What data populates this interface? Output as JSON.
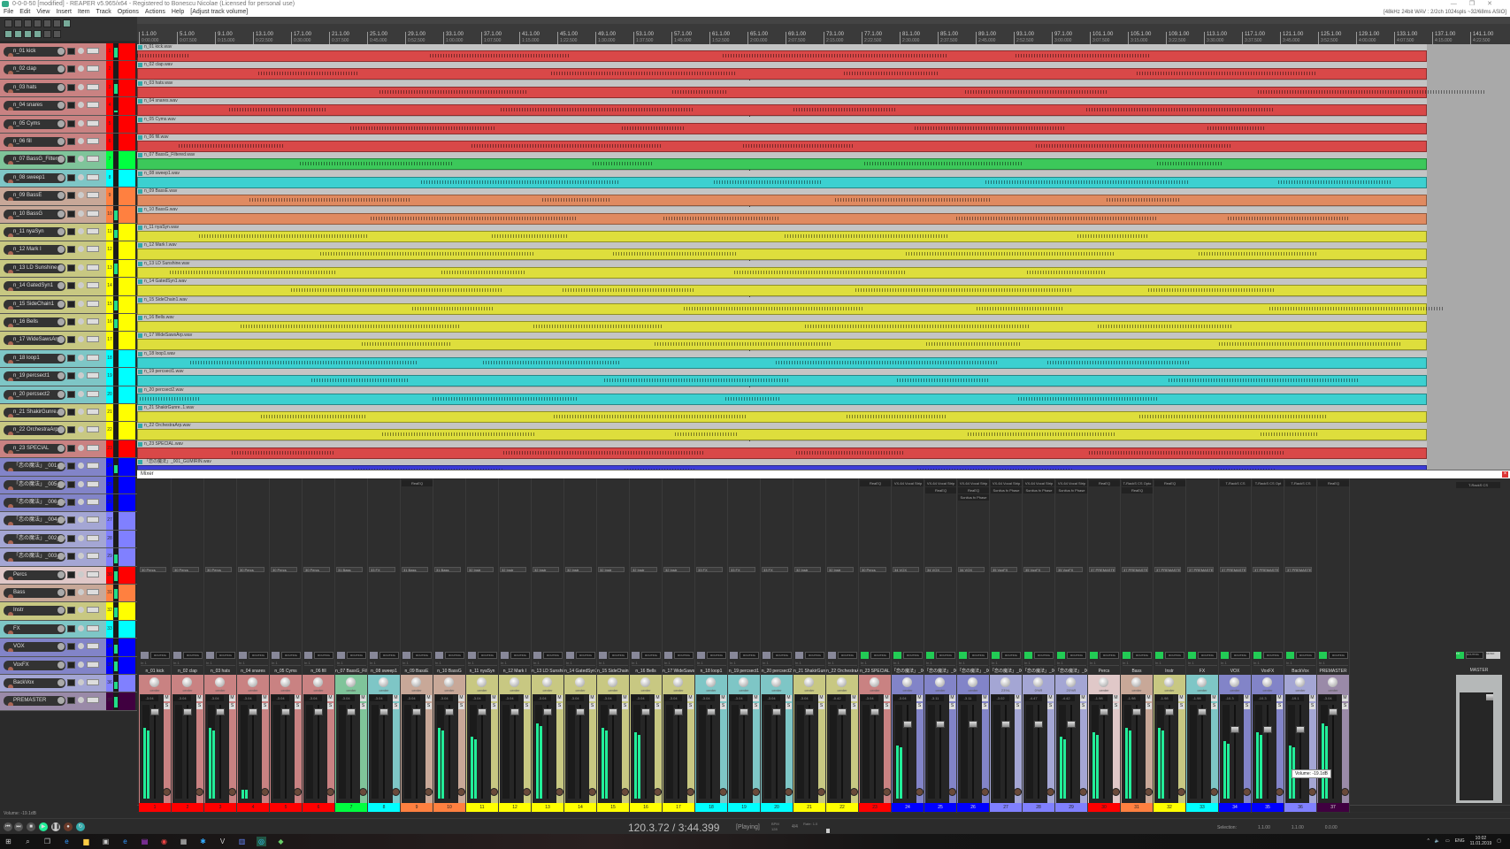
{
  "window": {
    "title": "0-0-0-50 [modified] - REAPER v5.965/x64 - Registered to Bonescu Nicolae (Licensed for personal use)",
    "controls": [
      "—",
      "❐",
      "✕"
    ]
  },
  "menu": {
    "items": [
      "File",
      "Edit",
      "View",
      "Insert",
      "Item",
      "Track",
      "Options",
      "Actions",
      "Help",
      "[Adjust track volume]"
    ],
    "audio_status": "[48kHz 24bit WAV : 2/2ch 1024spls ~32/68ms ASIO]"
  },
  "ruler": {
    "bars": [
      "1.1.00",
      "5.1.00",
      "9.1.00",
      "13.1.00",
      "17.1.00",
      "21.1.00",
      "25.1.00",
      "29.1.00",
      "33.1.00",
      "37.1.00",
      "41.1.00",
      "45.1.00",
      "49.1.00",
      "53.1.00",
      "57.1.00",
      "61.1.00",
      "65.1.00",
      "69.1.00",
      "73.1.00",
      "77.1.00",
      "81.1.00",
      "85.1.00",
      "89.1.00",
      "93.1.00",
      "97.1.00",
      "101.1.00",
      "105.1.00",
      "109.1.00",
      "113.1.00",
      "117.1.00",
      "121.1.00",
      "125.1.00",
      "129.1.00",
      "133.1.00",
      "137.1.00",
      "141.1.00"
    ],
    "times": [
      "0:00.000",
      "0:07.500",
      "0:15.000",
      "0:22.500",
      "0:30.000",
      "0:37.500",
      "0:45.000",
      "0:52.500",
      "1:00.000",
      "1:07.500",
      "1:15.000",
      "1:22.500",
      "1:30.000",
      "1:37.500",
      "1:45.000",
      "1:52.500",
      "2:00.000",
      "2:07.500",
      "2:15.000",
      "2:22.500",
      "2:30.000",
      "2:37.500",
      "2:45.000",
      "2:52.500",
      "3:00.000",
      "3:07.500",
      "3:15.000",
      "3:22.500",
      "3:30.000",
      "3:37.500",
      "3:45.000",
      "3:52.500",
      "4:00.000",
      "4:07.500",
      "4:15.000",
      "4:22.500"
    ]
  },
  "tracks": [
    {
      "num": "1",
      "name": "n_01 kick",
      "item": "n_01 kick.wav",
      "color": "#ff0000",
      "tint": "#c98282",
      "item_color": "#d94848",
      "meter": 0.8,
      "pan": "center",
      "vol": "-3.04",
      "send": "30 Percs",
      "fx": []
    },
    {
      "num": "2",
      "name": "n_02 clap",
      "item": "n_02 clap.wav",
      "color": "#ff0000",
      "tint": "#c98282",
      "item_color": "#d94848",
      "meter": 0,
      "pan": "center",
      "vol": "-3.04",
      "send": "30 Percs",
      "fx": []
    },
    {
      "num": "3",
      "name": "n_03 hats",
      "item": "n_03 hats.wav",
      "color": "#ff0000",
      "tint": "#c98282",
      "item_color": "#d94848",
      "meter": 0.8,
      "pan": "center",
      "vol": "-3.04",
      "send": "30 Percs",
      "fx": []
    },
    {
      "num": "4",
      "name": "n_04 snares",
      "item": "n_04 snares.wav",
      "color": "#ff0000",
      "tint": "#c98282",
      "item_color": "#d94848",
      "meter": 0.1,
      "pan": "center",
      "vol": "-3.04",
      "send": "30 Percs",
      "fx": []
    },
    {
      "num": "5",
      "name": "n_05 Cyms",
      "item": "n_05 Cyms.wav",
      "color": "#ff0000",
      "tint": "#c98282",
      "item_color": "#d94848",
      "meter": 0,
      "pan": "center",
      "vol": "-3.04",
      "send": "30 Percs",
      "fx": []
    },
    {
      "num": "6",
      "name": "n_06 fill",
      "item": "n_06 fill.wav",
      "color": "#ff0000",
      "tint": "#c98282",
      "item_color": "#d94848",
      "meter": 0,
      "pan": "center",
      "vol": "-3.04",
      "send": "30 Percs",
      "fx": []
    },
    {
      "num": "7",
      "name": "n_07 BassG_Filtered",
      "item": "n_07 BassG_Filtered.wav",
      "color": "#00ff40",
      "tint": "#7fc49a",
      "item_color": "#3cc85a",
      "meter": 0,
      "pan": "center",
      "vol": "-3.04",
      "send": "31 Bass",
      "fx": []
    },
    {
      "num": "8",
      "name": "n_08 sweep1",
      "item": "n_08 sweep1.wav",
      "color": "#00ffff",
      "tint": "#7ec6c6",
      "item_color": "#3cd0d0",
      "meter": 0,
      "pan": "center",
      "vol": "-3.04",
      "send": "33 FX",
      "fx": []
    },
    {
      "num": "9",
      "name": "n_09 BassE",
      "item": "n_09 BassE.wav",
      "color": "#ff8040",
      "tint": "#c8a898",
      "item_color": "#e08a60",
      "meter": 0,
      "pan": "center",
      "vol": "-3.04",
      "send": "31 Bass",
      "fx": [
        "ReaEQ"
      ]
    },
    {
      "num": "10",
      "name": "n_10 BassG",
      "item": "n_10 BassG.wav",
      "color": "#ff8040",
      "tint": "#c8a898",
      "item_color": "#e08a60",
      "meter": 0.8,
      "pan": "center",
      "vol": "-3.04",
      "send": "31 Bass",
      "fx": []
    },
    {
      "num": "11",
      "name": "n_11 nyaSyn",
      "item": "n_11 nyaSyn.wav",
      "color": "#ffff00",
      "tint": "#c8c882",
      "item_color": "#dede3c",
      "meter": 0.7,
      "pan": "center",
      "vol": "-3.04",
      "send": "32 Instr",
      "fx": []
    },
    {
      "num": "12",
      "name": "n_12 Mark I",
      "item": "n_12 Mark I.wav",
      "color": "#ffff00",
      "tint": "#c8c882",
      "item_color": "#dede3c",
      "meter": 0,
      "pan": "center",
      "vol": "-3.04",
      "send": "32 Instr",
      "fx": []
    },
    {
      "num": "13",
      "name": "n_13 LD Sunshine",
      "item": "n_13 LD Sunshine.wav",
      "color": "#ffff00",
      "tint": "#c8c882",
      "item_color": "#dede3c",
      "meter": 0.85,
      "pan": "center",
      "vol": "-3.04",
      "send": "32 Instr",
      "fx": []
    },
    {
      "num": "14",
      "name": "n_14 GatedSyn1",
      "item": "n_14 GatedSyn1.wav",
      "color": "#ffff00",
      "tint": "#c8c882",
      "item_color": "#dede3c",
      "meter": 0,
      "pan": "center",
      "vol": "-3.04",
      "send": "32 Instr",
      "fx": []
    },
    {
      "num": "15",
      "name": "n_15 SideChain1",
      "item": "n_15 SideChain1.wav",
      "color": "#ffff00",
      "tint": "#c8c882",
      "item_color": "#dede3c",
      "meter": 0.8,
      "pan": "center",
      "vol": "-3.04",
      "send": "32 Instr",
      "fx": []
    },
    {
      "num": "16",
      "name": "n_16 Bells",
      "item": "n_16 Bells.wav",
      "color": "#ffff00",
      "tint": "#c8c882",
      "item_color": "#dede3c",
      "meter": 0.75,
      "pan": "center",
      "vol": "-3.04",
      "send": "32 Instr",
      "fx": []
    },
    {
      "num": "17",
      "name": "n_17 WideSawsArp",
      "item": "n_17 WideSawsArp.wav",
      "color": "#ffff00",
      "tint": "#c8c882",
      "item_color": "#dede3c",
      "meter": 0,
      "pan": "center",
      "vol": "-3.04",
      "send": "32 Instr",
      "fx": []
    },
    {
      "num": "18",
      "name": "n_18 loop1",
      "item": "n_18 loop1.wav",
      "color": "#00ffff",
      "tint": "#7ec6c6",
      "item_color": "#3cd0d0",
      "meter": 0,
      "pan": "center",
      "vol": "-3.04",
      "send": "33 FX",
      "fx": []
    },
    {
      "num": "19",
      "name": "n_19 percsect1",
      "item": "n_19 percsect1.wav",
      "color": "#00ffff",
      "tint": "#7ec6c6",
      "item_color": "#3cd0d0",
      "meter": 0,
      "pan": "center",
      "vol": "-3.04",
      "send": "33 FX",
      "fx": []
    },
    {
      "num": "20",
      "name": "n_20 percsect2",
      "item": "n_20 percsect2.wav",
      "color": "#00ffff",
      "tint": "#7ec6c6",
      "item_color": "#3cd0d0",
      "meter": 0,
      "pan": "center",
      "vol": "-3.04",
      "send": "33 FX",
      "fx": []
    },
    {
      "num": "21",
      "name": "n_21 ShakirGunre..1",
      "item": "n_21 ShakirGunre..1.wav",
      "color": "#ffff00",
      "tint": "#c8c882",
      "item_color": "#dede3c",
      "meter": 0,
      "pan": "center",
      "vol": "-3.04",
      "send": "32 Instr",
      "fx": []
    },
    {
      "num": "22",
      "name": "n_22 OrchestraArp",
      "item": "n_22 OrchestraArp.wav",
      "color": "#ffff00",
      "tint": "#c8c882",
      "item_color": "#dede3c",
      "meter": 0,
      "pan": "center",
      "vol": "-0.42",
      "send": "32 Instr",
      "fx": []
    },
    {
      "num": "23",
      "name": "n_23 SPECIAL",
      "item": "n_23 SPECIAL.wav",
      "color": "#ff0000",
      "tint": "#c98282",
      "item_color": "#d94848",
      "meter": 0,
      "pan": "center",
      "vol": "-3.04",
      "send": "30 Percs",
      "fx": [
        "ReaEQ"
      ]
    },
    {
      "num": "24",
      "name": "「恋の魔法」_001_GUMI",
      "item": "「恋の魔法」_001_GUMIRIN.wav",
      "color": "#0000ff",
      "tint": "#8284c8",
      "item_color": "#3c3cd8",
      "meter": 0.6,
      "pan": "center",
      "vol": "-3.04",
      "send": "34 VOX",
      "fx": [
        "VX-64 Vocal Strip"
      ]
    },
    {
      "num": "25",
      "name": "「恋の魔法」_005_GUMI",
      "item": "",
      "color": "#0000ff",
      "tint": "#8284c8",
      "item_color": "#3c3cd8",
      "meter": 0,
      "pan": "center",
      "vol": "-3.11",
      "send": "34 VOX",
      "fx": [
        "VX-64 Vocal Strip",
        "ReaEQ"
      ]
    },
    {
      "num": "26",
      "name": "「恋の魔法」_006_GUMI",
      "item": "",
      "color": "#0000ff",
      "tint": "#8284c8",
      "item_color": "#3c3cd8",
      "meter": 0,
      "pan": "center",
      "vol": "-3.11",
      "send": "34 VOX",
      "fx": [
        "VX-64 Vocal Strip",
        "ReaEQ",
        "Sonitus fx Phase"
      ]
    },
    {
      "num": "27",
      "name": "「恋の魔法」_004_GI_1",
      "item": "",
      "color": "#8080ff",
      "tint": "#a4a6d4",
      "item_color": "#8080ff",
      "meter": 0,
      "pan": "23%L",
      "vol": "-3.02",
      "send": "35 VoxFX",
      "fx": [
        "VX-64 Vocal Strip",
        "Sonitus fx Phase"
      ]
    },
    {
      "num": "28",
      "name": "「恋の魔法」_002_GI_2",
      "item": "",
      "color": "#8080ff",
      "tint": "#a4a6d4",
      "item_color": "#8080ff",
      "meter": 0,
      "pan": "0%R",
      "vol": "-4.47",
      "send": "35 VoxFX",
      "fx": [
        "VX-64 Vocal Strip",
        "Sonitus fx Phase"
      ]
    },
    {
      "num": "29",
      "name": "「恋の魔法」_003_GI_3",
      "item": "",
      "color": "#8080ff",
      "tint": "#a4a6d4",
      "item_color": "#8080ff",
      "meter": 0.7,
      "pan": "20%R",
      "vol": "-4.42",
      "send": "35 VoxFX",
      "fx": [
        "VX-64 Vocal Strip",
        "Sonitus fx Phase"
      ]
    },
    {
      "num": "30",
      "name": "Percs",
      "item": "",
      "color": "#ff0000",
      "tint": "#e0c8c8",
      "item_color": "#d94848",
      "meter": 0.75,
      "pan": "center",
      "vol": "-1.98",
      "send": "37 PREMASTER",
      "fx": [
        "ReaEQ"
      ]
    },
    {
      "num": "31",
      "name": "Bass",
      "item": "",
      "color": "#ff8040",
      "tint": "#c8a898",
      "item_color": "#e08a60",
      "meter": 0.8,
      "pan": "center",
      "vol": "-1.98",
      "send": "37 PREMASTER",
      "fx": [
        "T-RackS CS Opto",
        "ReaEQ"
      ]
    },
    {
      "num": "32",
      "name": "Instr",
      "item": "",
      "color": "#ffff00",
      "tint": "#c8c882",
      "item_color": "#dede3c",
      "meter": 0.8,
      "pan": "center",
      "vol": "-1.98",
      "send": "37 PREMASTER",
      "fx": [
        "ReaEQ"
      ]
    },
    {
      "num": "33",
      "name": "FX",
      "item": "",
      "color": "#00ffff",
      "tint": "#7ec6c6",
      "item_color": "#3cd0d0",
      "meter": 0,
      "pan": "center",
      "vol": "-1.98",
      "send": "37 PREMASTER",
      "fx": []
    },
    {
      "num": "34",
      "name": "VOX",
      "item": "",
      "color": "#0000ff",
      "tint": "#8284c8",
      "item_color": "#3c3cd8",
      "meter": 0.65,
      "pan": "center",
      "vol": "-10.3",
      "send": "37 PREMASTER",
      "fx": [
        "T-RackS CS"
      ]
    },
    {
      "num": "35",
      "name": "VoxFX",
      "item": "",
      "color": "#0000ff",
      "tint": "#8284c8",
      "item_color": "#3c3cd8",
      "meter": 0.75,
      "pan": "center",
      "vol": "-10.3",
      "send": "37 PREMASTER",
      "fx": [
        "T-RackS CS Opt"
      ]
    },
    {
      "num": "36",
      "name": "BackVox",
      "item": "",
      "color": "#8080ff",
      "tint": "#a4a6d4",
      "item_color": "#8080ff",
      "meter": 0.6,
      "pan": "center",
      "vol": "-19.1",
      "send": "37 PREMASTER",
      "fx": [
        "T-RackS CS"
      ]
    },
    {
      "num": "37",
      "name": "PREMASTER",
      "item": "",
      "color": "#400040",
      "tint": "#9a8aa8",
      "item_color": "#8060a0",
      "meter": 0.85,
      "pan": "center",
      "vol": "-3.04",
      "send": "",
      "fx": [
        "ReaEQ"
      ]
    }
  ],
  "mixer": {
    "title": "Mixer",
    "master_label": "MASTER",
    "master_fx": "T-RackS CS",
    "fx_label": "FX",
    "routing_label": "ROUTING",
    "mono_label": "MONO",
    "input_label": "In 1",
    "mute": "M",
    "solo": "S",
    "tooltip": "Volume: -19.1dB"
  },
  "status": {
    "volume": "Volume: -19.1dB"
  },
  "transport": {
    "position": "120.3.72 / 3:44.399",
    "state": "[Playing]",
    "bpm_label": "BPM",
    "bpm": "128",
    "time_sig": "4/4",
    "rate_label": "Rate:",
    "rate": "1.0",
    "selection_label": "Selection:",
    "sel_start": "1.1.00",
    "sel_end": "1.1.00",
    "sel_len": "0.0.00"
  },
  "taskbar": {
    "lang": "ENG",
    "time": "10:02",
    "date": "11.01.2019"
  }
}
